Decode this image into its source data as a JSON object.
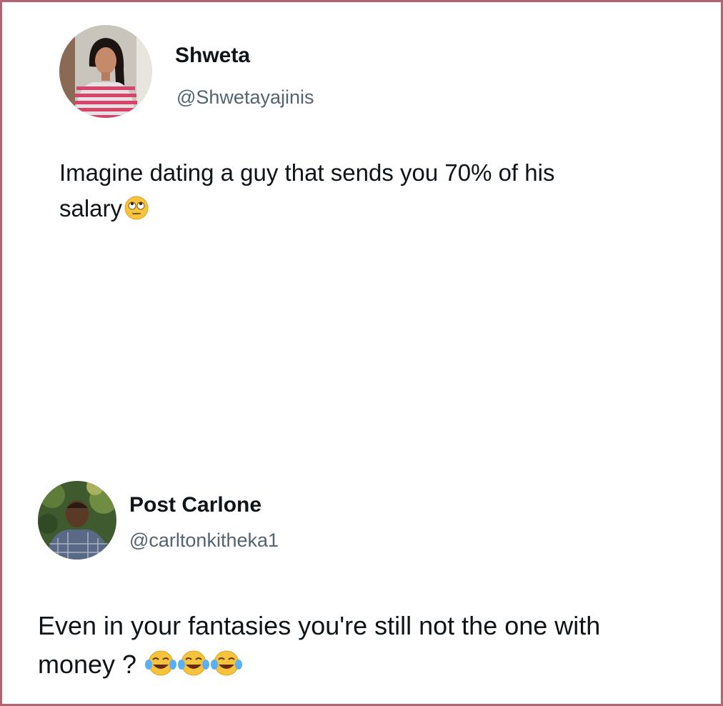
{
  "posts": [
    {
      "author_name": "Shweta",
      "author_handle": "@Shwetayajinis",
      "body_line1": "Imagine dating a guy that sends you 70% of his",
      "body_line2": "salary",
      "emoji": [
        "face-with-rolling-eyes"
      ]
    },
    {
      "author_name": "Post Carlone",
      "author_handle": "@carltonkitheka1",
      "body_line1": "Even in your fantasies you're still not the one with",
      "body_line2": "money ?",
      "emoji": [
        "face-with-tears-of-joy",
        "face-with-tears-of-joy",
        "face-with-tears-of-joy"
      ]
    }
  ],
  "colors": {
    "border": "#b46470",
    "text": "#0f1419",
    "handle": "#536471"
  }
}
